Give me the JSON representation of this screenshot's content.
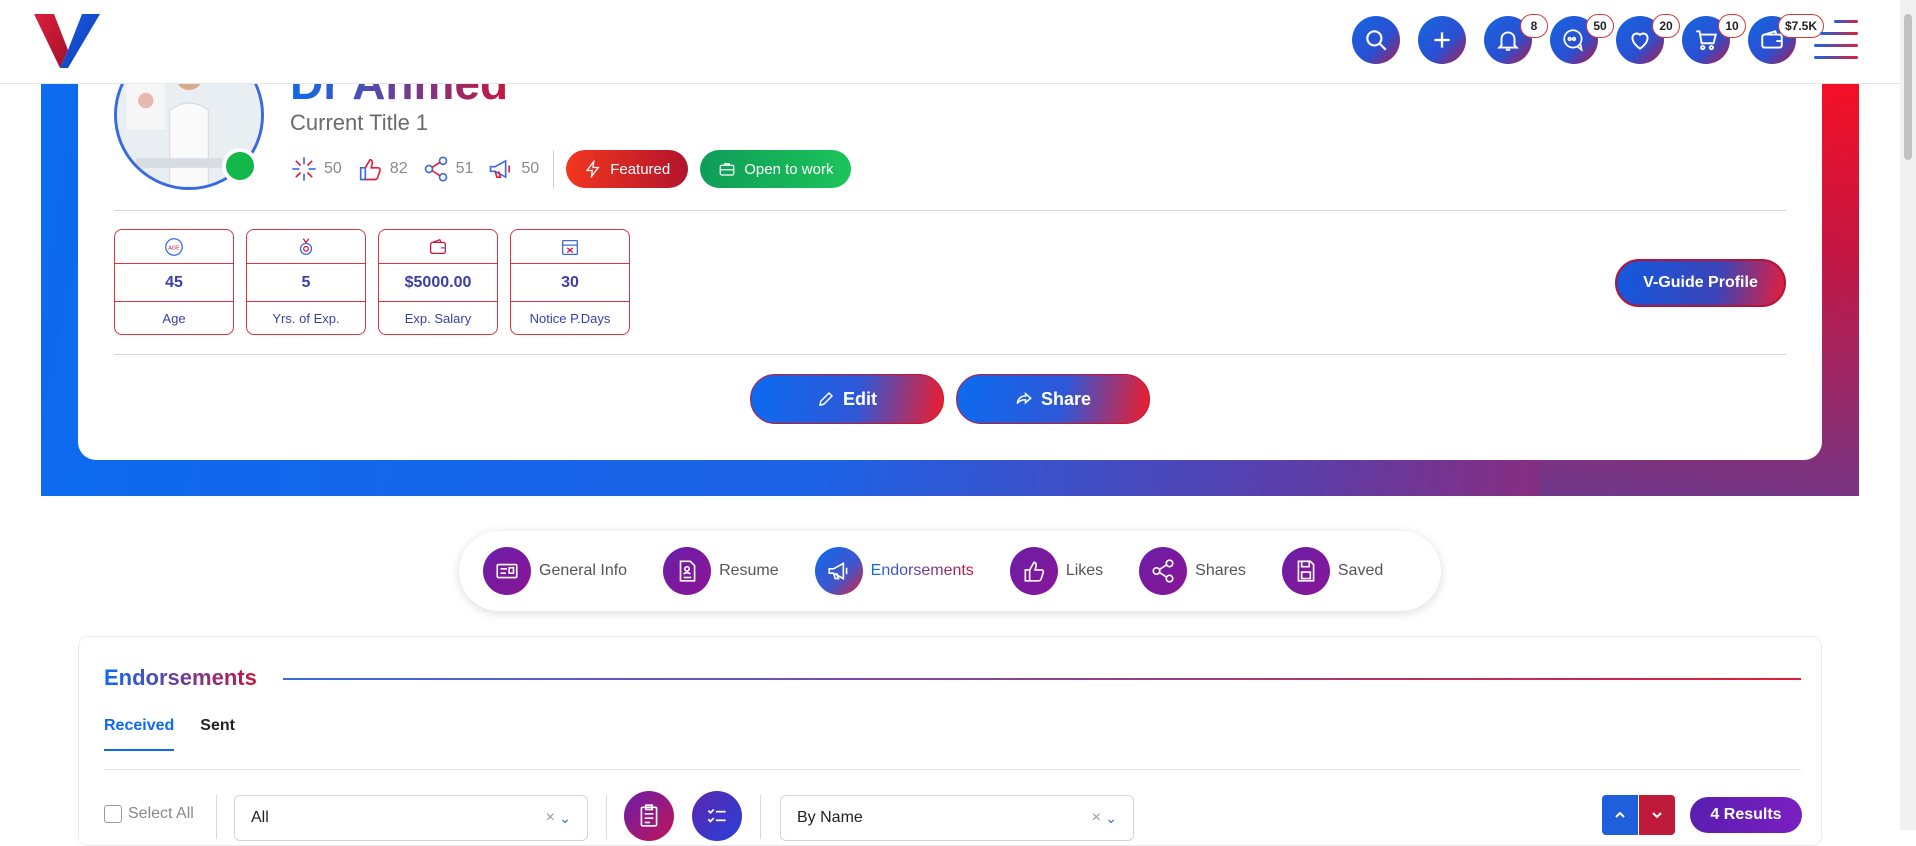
{
  "header": {
    "badges": {
      "notifications": "8",
      "messages": "50",
      "favorites": "20",
      "cart": "10",
      "wallet": "$7.5K"
    }
  },
  "profile": {
    "name": "Dr Ahmed",
    "title": "Current Title 1",
    "stats": {
      "views": "50",
      "likes": "82",
      "shares": "51",
      "endorsements": "50"
    },
    "tags": {
      "featured": "Featured",
      "open_to_work": "Open to work"
    },
    "info": [
      {
        "value": "45",
        "label": "Age",
        "icon": "age-icon"
      },
      {
        "value": "5",
        "label": "Yrs. of Exp.",
        "icon": "experience-icon"
      },
      {
        "value": "$5000.00",
        "label": "Exp. Salary",
        "icon": "wallet-icon"
      },
      {
        "value": "30",
        "label": "Notice P.Days",
        "icon": "calendar-icon"
      }
    ],
    "vguide_label": "V-Guide Profile",
    "edit_label": "Edit",
    "share_label": "Share"
  },
  "tabs": [
    {
      "label": "General Info",
      "icon": "id-card-icon"
    },
    {
      "label": "Resume",
      "icon": "resume-icon"
    },
    {
      "label": "Endorsements",
      "icon": "megaphone-icon",
      "active": true
    },
    {
      "label": "Likes",
      "icon": "thumbs-up-icon"
    },
    {
      "label": "Shares",
      "icon": "share-icon"
    },
    {
      "label": "Saved",
      "icon": "save-icon"
    }
  ],
  "endorsements": {
    "title": "Endorsements",
    "subtabs": [
      "Received",
      "Sent"
    ],
    "select_all": "Select All",
    "filter_value": "All",
    "sort_value": "By Name",
    "results": "4 Results"
  },
  "colors": {
    "primary_blue": "#0c6bef",
    "accent_red": "#e01e3a",
    "purple": "#6a1ea8",
    "green": "#12b84a"
  }
}
